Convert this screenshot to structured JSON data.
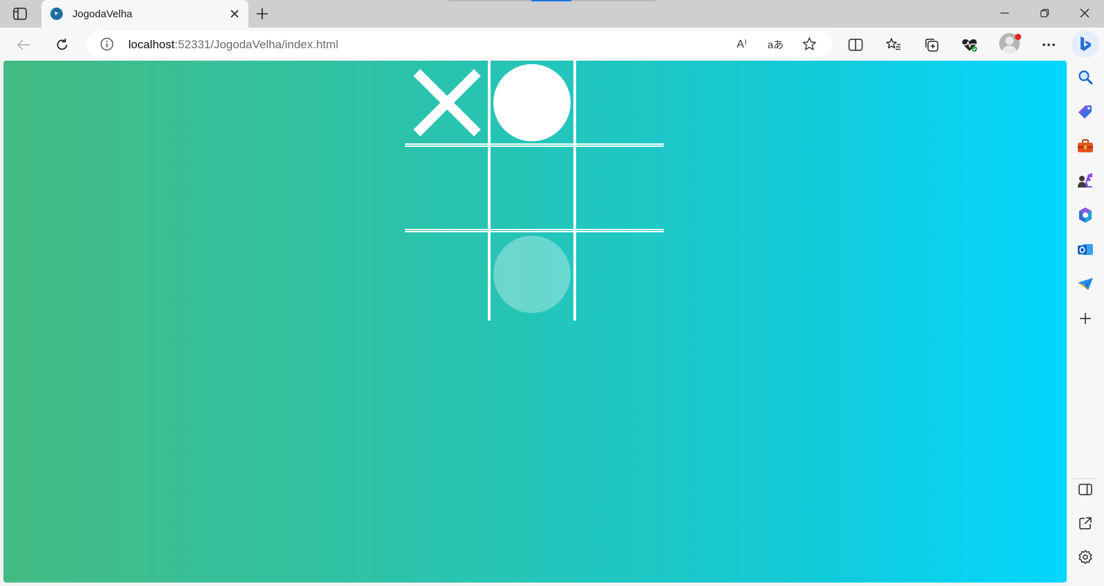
{
  "tab": {
    "title": "JogodaVelha"
  },
  "address_bar": {
    "url_host": "localhost",
    "url_rest": ":52331/JogodaVelha/index.html",
    "read_aloud_label": "A⁾",
    "translate_label": "aあ"
  },
  "colors": {
    "gradient_start": "#43bb82",
    "gradient_end": "#03d6fd",
    "board_lines": "#ffffff",
    "loading_accent": "#1a73e8"
  },
  "game": {
    "cells": [
      {
        "row": 1,
        "col": 1,
        "mark": "X"
      },
      {
        "row": 1,
        "col": 2,
        "mark": "O"
      },
      {
        "row": 1,
        "col": 3,
        "mark": ""
      },
      {
        "row": 2,
        "col": 1,
        "mark": ""
      },
      {
        "row": 2,
        "col": 2,
        "mark": ""
      },
      {
        "row": 2,
        "col": 3,
        "mark": ""
      },
      {
        "row": 3,
        "col": 1,
        "mark": ""
      },
      {
        "row": 3,
        "col": 2,
        "mark": "O-hover-preview"
      },
      {
        "row": 3,
        "col": 3,
        "mark": ""
      }
    ]
  },
  "icons": {
    "toolbar": [
      "tab-actions-icon",
      "close-tab-icon",
      "new-tab-icon",
      "minimize-icon",
      "restore-icon",
      "close-window-icon",
      "back-icon",
      "refresh-icon",
      "site-info-icon",
      "read-aloud-icon",
      "translate-icon",
      "favorite-star-icon",
      "split-screen-icon",
      "favorites-icon",
      "collections-icon",
      "browser-essentials-icon",
      "profile-icon",
      "more-menu-icon",
      "bing-copilot-icon"
    ],
    "sidebar": [
      "search-icon",
      "shopping-tag-icon",
      "tools-icon",
      "games-icon",
      "microsoft-365-icon",
      "outlook-icon",
      "drop-icon",
      "add-icon",
      "hide-sidebar-icon",
      "open-external-icon",
      "settings-icon"
    ]
  }
}
